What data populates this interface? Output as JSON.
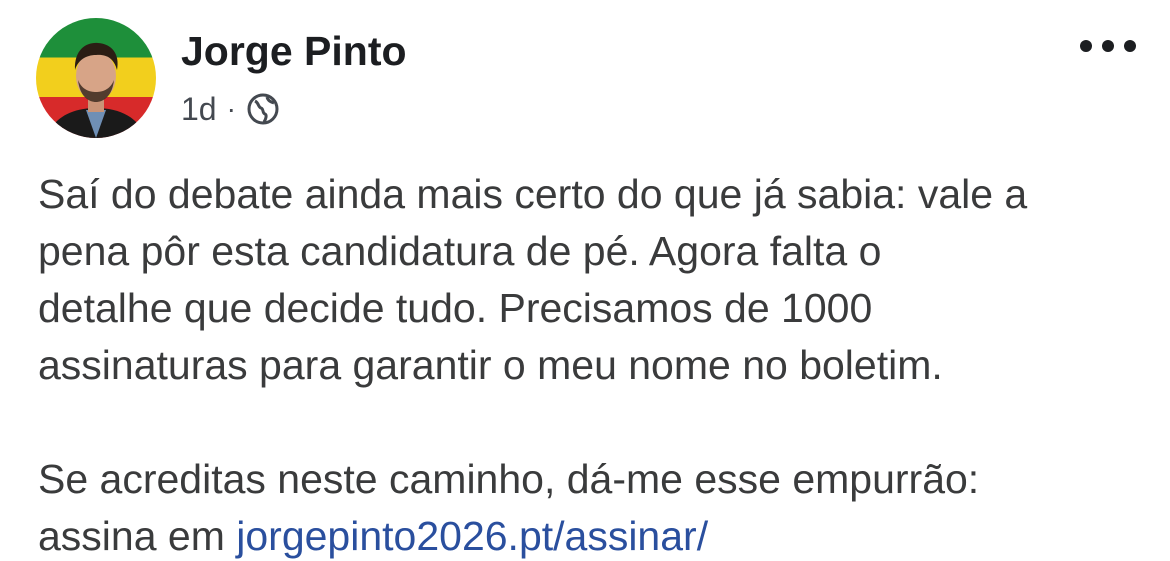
{
  "post": {
    "author": "Jorge Pinto",
    "timestamp": "1d",
    "separator": "·",
    "audience_icon": "globe-icon",
    "more_icon": "more-options-icon",
    "text_lines": [
      "Saí do debate ainda mais certo do que já sabia: vale a",
      "pena pôr esta candidatura de pé. Agora falta o",
      "detalhe que decide tudo. Precisamos de 1000",
      "assinaturas para garantir o meu nome no boletim."
    ],
    "text_lines_2": [
      "Se acreditas neste caminho, dá-me esse empurrão:"
    ],
    "link_prefix": "assina em ",
    "link_text": "jorgepinto2026.pt/assinar/"
  },
  "colors": {
    "text": "#3a3b3c",
    "link": "#2a4f9e",
    "avatar_green": "#1e8f3a",
    "avatar_yellow": "#f2cf1d",
    "avatar_red": "#d72a2a"
  }
}
